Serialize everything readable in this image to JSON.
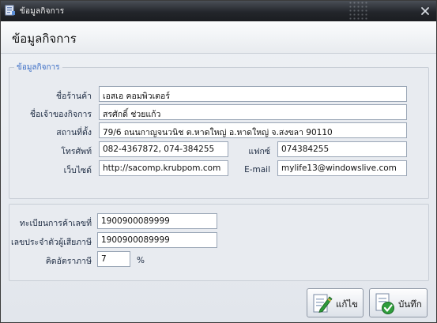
{
  "window": {
    "title": "ข้อมูลกิจการ"
  },
  "header": {
    "title": "ข้อมูลกิจการ"
  },
  "business_group": {
    "legend": "ข้อมูลกิจการ",
    "shop_name": {
      "label": "ชื่อร้านค้า",
      "value": "เอสเอ คอมพิวเตอร์"
    },
    "owner_name": {
      "label": "ชื่อเจ้าของกิจการ",
      "value": "สรศักดิ์ ช่วยแก้ว"
    },
    "address": {
      "label": "สถานที่ตั้ง",
      "value": "79/6 ถนนกาญจนวนิช ต.หาดใหญ่ อ.หาดใหญ่ จ.สงขลา 90110"
    },
    "phone": {
      "label": "โทรศัพท์",
      "value": "082-4367872, 074-384255"
    },
    "fax": {
      "label": "แฟกซ์",
      "value": "074384255"
    },
    "website": {
      "label": "เว็บไซต์",
      "value": "http://sacomp.krubpom.com"
    },
    "email": {
      "label": "E-mail",
      "value": "mylife13@windowslive.com"
    }
  },
  "tax_group": {
    "commerce_reg": {
      "label": "ทะเบียนการค้าเลขที่",
      "value": "1900900089999"
    },
    "tax_id": {
      "label": "เลขประจำตัวผู้เสียภาษี",
      "value": "1900900089999"
    },
    "vat_rate": {
      "label": "คิดอัตราภาษี",
      "value": "7",
      "unit": "%"
    }
  },
  "buttons": {
    "edit_label": "แก้ไข",
    "save_label": "บันทึก"
  },
  "icons": {
    "app": "form-icon",
    "close": "close-icon",
    "edit": "edit-pen-icon",
    "save": "save-check-icon"
  },
  "colors": {
    "legend": "#3d6fc6",
    "titlebar": "#23262b"
  }
}
